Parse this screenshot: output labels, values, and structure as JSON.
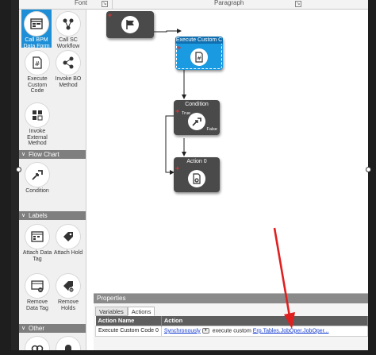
{
  "ribbon": {
    "groups": [
      "Font",
      "Paragraph"
    ]
  },
  "toolbox": {
    "top_tools": [
      {
        "label": "Call BPM Data Form",
        "icon": "call-bpm-data-form-icon",
        "selected": true
      },
      {
        "label": "Call SC Workflow",
        "icon": "call-sc-workflow-icon",
        "selected": false
      },
      {
        "label": "Execute Custom Code",
        "icon": "execute-custom-code-icon",
        "selected": false
      },
      {
        "label": "Invoke BO Method",
        "icon": "invoke-bo-method-icon",
        "selected": false
      },
      {
        "label": "Invoke External Method",
        "icon": "invoke-external-method-icon",
        "selected": false
      }
    ],
    "sections": [
      {
        "title": "Flow Chart",
        "tools": [
          {
            "label": "Condition",
            "icon": "condition-icon"
          }
        ]
      },
      {
        "title": "Labels",
        "tools": [
          {
            "label": "Attach Data Tag",
            "icon": "attach-data-tag-icon"
          },
          {
            "label": "Attach Hold",
            "icon": "attach-hold-icon"
          },
          {
            "label": "Remove Data Tag",
            "icon": "remove-data-tag-icon"
          },
          {
            "label": "Remove Holds",
            "icon": "remove-holds-icon"
          }
        ]
      },
      {
        "title": "Other",
        "tools": []
      }
    ]
  },
  "canvas": {
    "nodes": {
      "start": {
        "title": "",
        "icon": "flag-icon"
      },
      "execute": {
        "title": "Execute Custom C",
        "icon": "hash-document-icon"
      },
      "condition": {
        "title": "Condition",
        "icon": "condition-arrow-icon",
        "true_label": "True",
        "false_label": "False"
      },
      "action": {
        "title": "Action 0",
        "icon": "delete-document-icon"
      }
    }
  },
  "properties": {
    "title": "Properties",
    "tabs": [
      "Variables",
      "Actions"
    ],
    "active_tab": "Actions",
    "columns": [
      "Action Name",
      "Action"
    ],
    "rows": [
      {
        "name": "Execute Custom Code 0",
        "mode": "Synchronously",
        "text": "execute custom",
        "target": "Erp.Tables.JobOper.JobOper..."
      }
    ]
  },
  "colors": {
    "accent": "#1e8fd6",
    "node": "#4a4a4a",
    "annotation_arrow": "#e02020"
  }
}
